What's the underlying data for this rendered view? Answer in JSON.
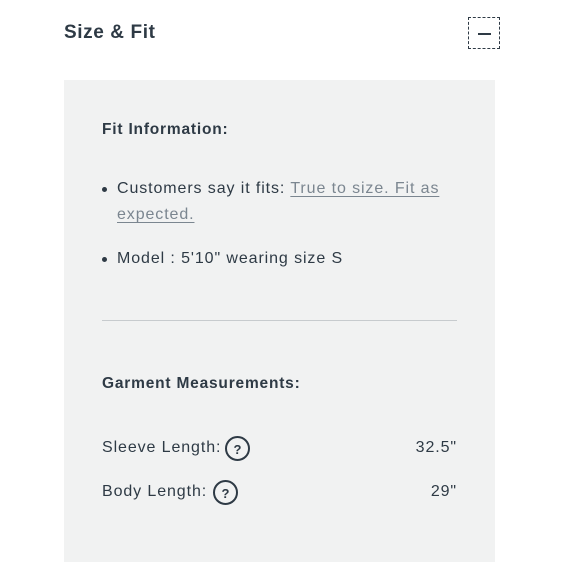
{
  "header": {
    "title": "Size & Fit",
    "collapse_icon": "minus-icon"
  },
  "fit_information": {
    "heading": "Fit Information:",
    "customers_say_label": "Customers say it fits: ",
    "customers_say_link": "True to size. Fit as expected.",
    "model_text": "Model : 5'10\" wearing size S"
  },
  "garment_measurements": {
    "heading": "Garment Measurements:",
    "help_glyph": "?",
    "rows": [
      {
        "label": "Sleeve Length:",
        "value": "32.5\""
      },
      {
        "label": "Body Length:",
        "value": "29\""
      }
    ]
  },
  "colors": {
    "text": "#2e3a45",
    "panel_background": "#f1f2f2",
    "link": "#7b8690",
    "divider": "#c7cbce"
  }
}
